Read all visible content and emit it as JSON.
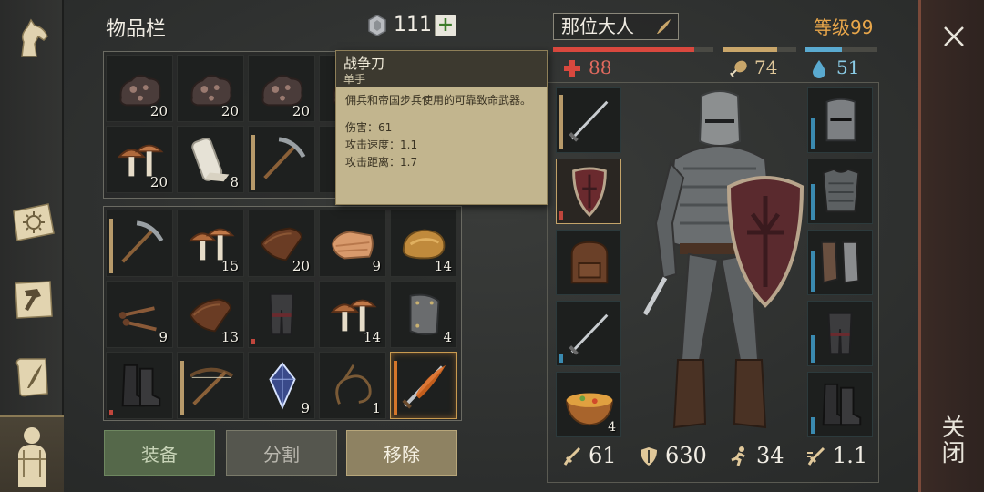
{
  "inventory": {
    "title": "物品栏",
    "currency": "111",
    "add_label": "+",
    "top_grid": [
      {
        "icon": "iron-ore-icon",
        "qty": "20"
      },
      {
        "icon": "iron-ore-icon",
        "qty": "20"
      },
      {
        "icon": "iron-ore-icon",
        "qty": "20"
      },
      {
        "icon": "iron-ore-icon",
        "qty": ""
      },
      {
        "icon": "mushroom-icon",
        "qty": "20"
      },
      {
        "icon": "cloth-roll-icon",
        "qty": "8"
      },
      {
        "icon": "pickaxe-icon",
        "qty": ""
      },
      {
        "icon": "empty",
        "qty": ""
      }
    ],
    "bottom_grid": [
      {
        "icon": "pickaxe-icon",
        "qty": ""
      },
      {
        "icon": "mushroom-icon",
        "qty": "15"
      },
      {
        "icon": "leather-icon",
        "qty": "20"
      },
      {
        "icon": "cloth-icon",
        "qty": "9"
      },
      {
        "icon": "bread-icon",
        "qty": "14"
      },
      {
        "icon": "nails-icon",
        "qty": "9"
      },
      {
        "icon": "leather-icon",
        "qty": "13"
      },
      {
        "icon": "leg-armor-icon",
        "qty": ""
      },
      {
        "icon": "mushroom-icon",
        "qty": "14"
      },
      {
        "icon": "metal-plate-icon",
        "qty": "4"
      },
      {
        "icon": "boots-icon",
        "qty": ""
      },
      {
        "icon": "crossbow-icon",
        "qty": ""
      },
      {
        "icon": "crystal-icon",
        "qty": "9"
      },
      {
        "icon": "rope-icon",
        "qty": "1"
      },
      {
        "icon": "fire-sword-icon",
        "qty": ""
      }
    ],
    "buttons": {
      "equip": "装备",
      "split": "分割",
      "remove": "移除"
    }
  },
  "tooltip": {
    "name": "战争刀",
    "type": "单手",
    "description": "佣兵和帝国步兵使用的可靠致命武器。",
    "damage": "伤害：61",
    "attack_speed": "攻击速度：1.1",
    "attack_range": "攻击距离：1.7"
  },
  "character": {
    "name": "那位大人",
    "level": "等级99",
    "health": "88",
    "hunger": "74",
    "thirst": "51",
    "health_fraction": 0.88,
    "hunger_fraction": 0.74,
    "thirst_fraction": 0.51,
    "stats": {
      "attack": "61",
      "armor": "630",
      "speed": "34",
      "attack_speed": "1.1"
    },
    "left_slots": [
      {
        "icon": "sword-icon",
        "qty": ""
      },
      {
        "icon": "shield-icon",
        "qty": ""
      },
      {
        "icon": "backpack-icon",
        "qty": ""
      },
      {
        "icon": "sword-icon",
        "qty": ""
      },
      {
        "icon": "soup-bowl-icon",
        "qty": "4"
      }
    ],
    "right_slots": [
      {
        "icon": "helmet-icon"
      },
      {
        "icon": "chest-armor-icon"
      },
      {
        "icon": "gauntlets-icon"
      },
      {
        "icon": "leg-armor-icon"
      },
      {
        "icon": "boots-icon"
      }
    ]
  },
  "close_label": "关闭",
  "colors": {
    "health": "#d9483e",
    "hunger": "#c9a66a",
    "thirst": "#5aaad0",
    "level": "#e8a64a",
    "accent": "#c89b50"
  }
}
